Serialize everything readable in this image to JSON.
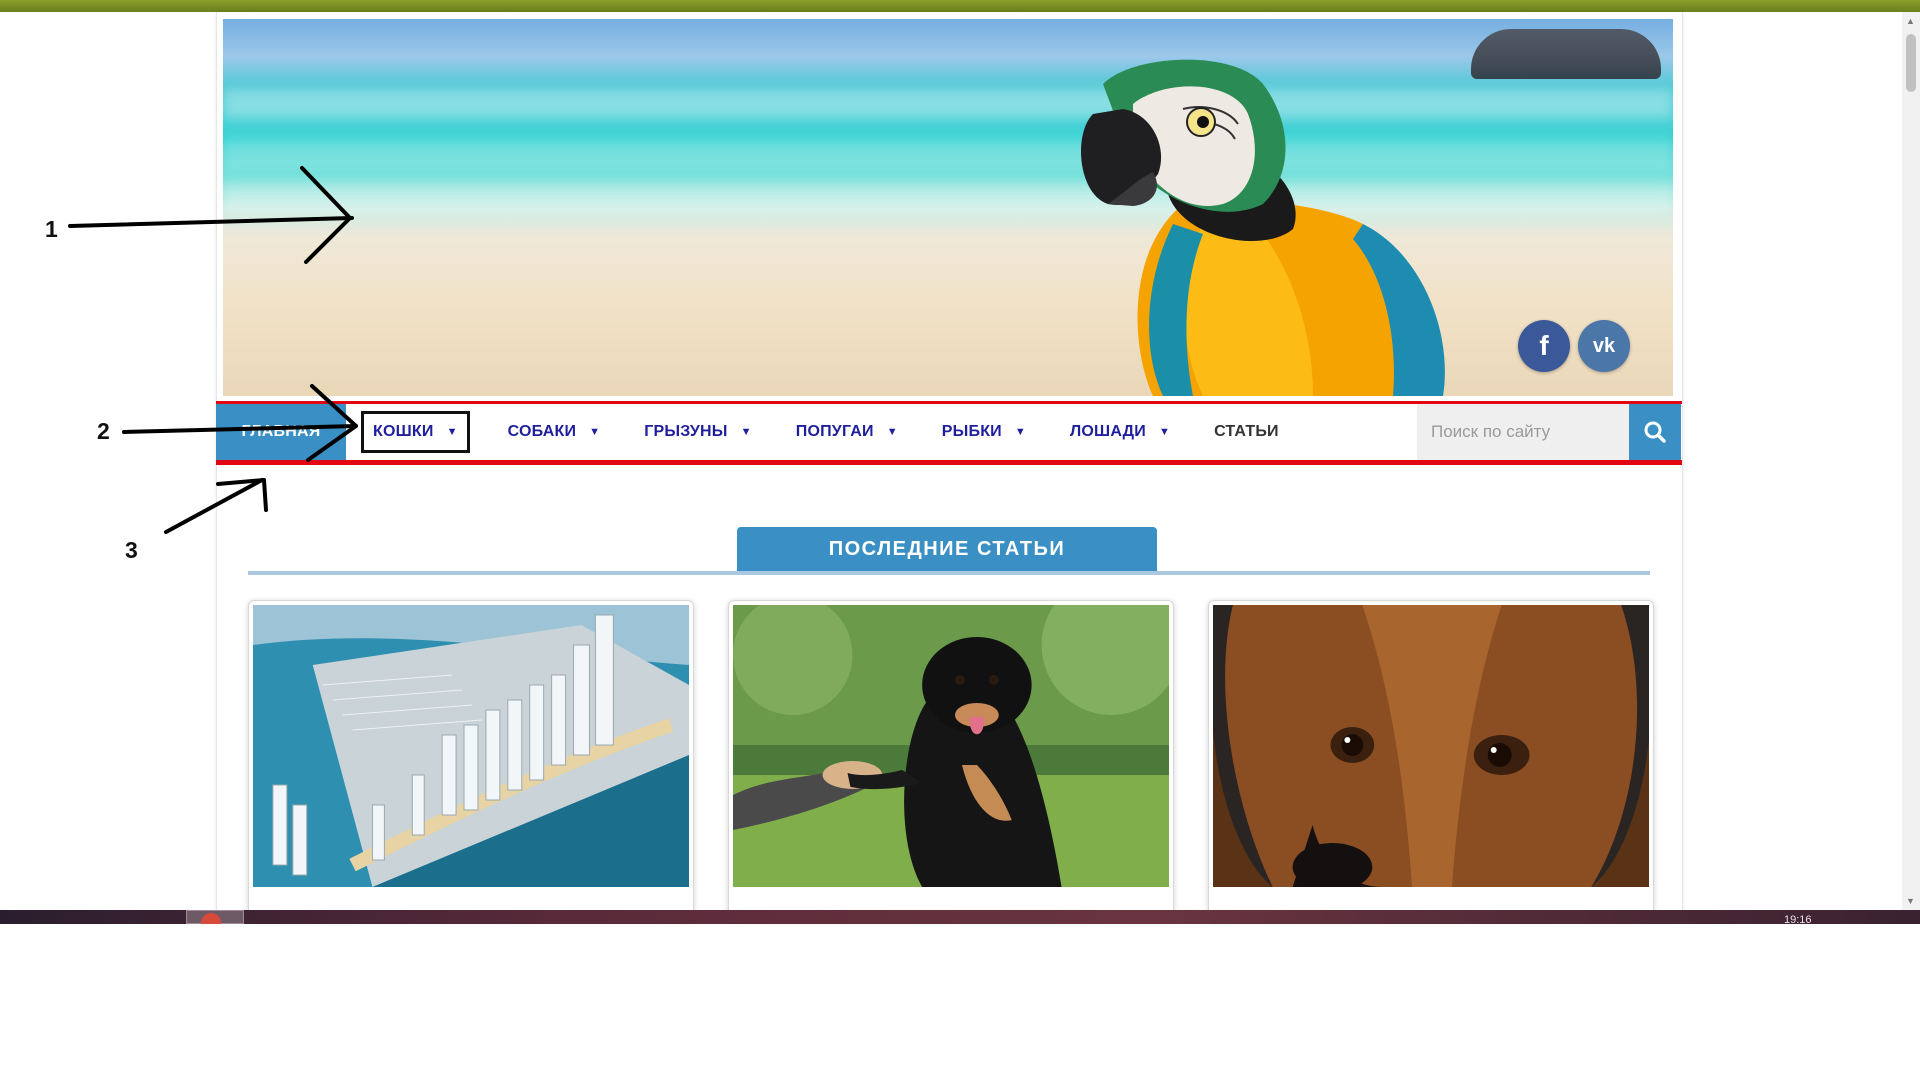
{
  "nav": {
    "home": "ГЛАВНАЯ",
    "cats": "КОШКИ",
    "dogs": "СОБАКИ",
    "rodents": "ГРЫЗУНЫ",
    "parrots": "ПОПУГАИ",
    "fish": "РЫБКИ",
    "horses": "ЛОШАДИ",
    "articles": "СТАТЬИ"
  },
  "search": {
    "placeholder": "Поиск по сайту",
    "icon": "search-icon"
  },
  "social": {
    "facebook": "f",
    "vk": "vk"
  },
  "section": {
    "title": "ПОСЛЕДНИЕ СТАТЬИ"
  },
  "cards": [
    {
      "image": "aerial-marina-city-photo"
    },
    {
      "image": "black-dog-paw-shake-photo"
    },
    {
      "image": "beagle-closeup-photo"
    }
  ],
  "annotations": {
    "label_1": "1",
    "label_2": "2",
    "label_3": "3"
  },
  "taskbar": {
    "clock": "19:16"
  },
  "colors": {
    "accent_blue": "#3a8fc5",
    "nav_border_red": "#e30613",
    "nav_text": "#1f1f9e",
    "top_strip_green": "#7a8e24"
  }
}
